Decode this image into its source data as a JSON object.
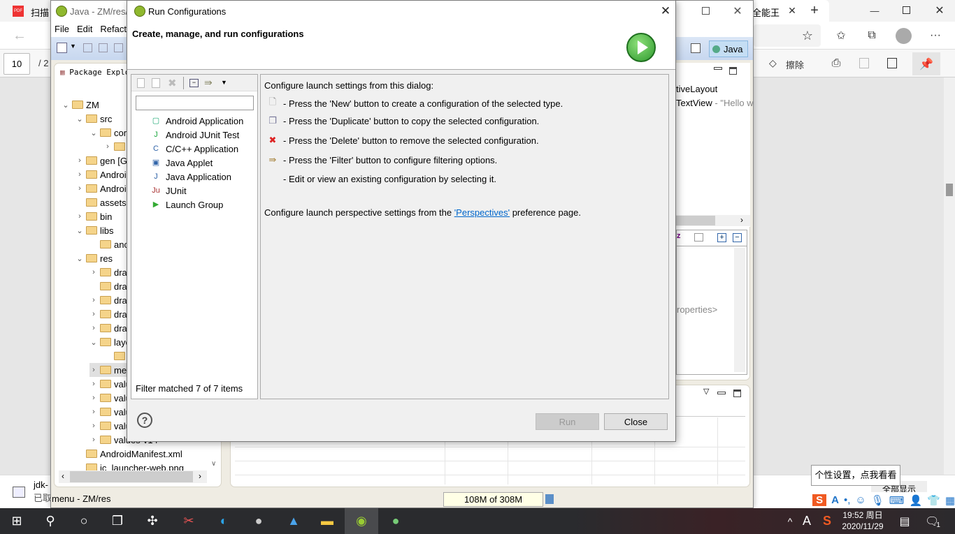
{
  "browser": {
    "tab1_title": "扫描",
    "tab2_title_fragment": "全能王",
    "page_input": "10",
    "page_total_fragment": "/ 2",
    "erase_label": "擦除",
    "download": {
      "name_fragment": "jdk-",
      "status_fragment": "已取",
      "show_all": "全部显示"
    }
  },
  "eclipse": {
    "title": "Java - ZM/res/",
    "menu": [
      "File",
      "Edit",
      "Refact"
    ],
    "perspective": "Java",
    "package_explorer_title": "Package Explor",
    "tree": [
      {
        "label": "ZM",
        "level": 0,
        "arrow": "open"
      },
      {
        "label": "src",
        "level": 1,
        "arrow": "open"
      },
      {
        "label": "cor",
        "level": 2,
        "arrow": "open"
      },
      {
        "label": "",
        "level": 3,
        "arrow": "closed"
      },
      {
        "label": "gen [G",
        "level": 1,
        "arrow": "closed"
      },
      {
        "label": "Androi",
        "level": 1,
        "arrow": "closed"
      },
      {
        "label": "Androi",
        "level": 1,
        "arrow": "closed"
      },
      {
        "label": "assets",
        "level": 1,
        "arrow": "none"
      },
      {
        "label": "bin",
        "level": 1,
        "arrow": "closed"
      },
      {
        "label": "libs",
        "level": 1,
        "arrow": "open"
      },
      {
        "label": "anc",
        "level": 2,
        "arrow": "none"
      },
      {
        "label": "res",
        "level": 1,
        "arrow": "open"
      },
      {
        "label": "dra",
        "level": 2,
        "arrow": "closed"
      },
      {
        "label": "dra",
        "level": 2,
        "arrow": "none"
      },
      {
        "label": "dra",
        "level": 2,
        "arrow": "closed"
      },
      {
        "label": "dra",
        "level": 2,
        "arrow": "closed"
      },
      {
        "label": "dra",
        "level": 2,
        "arrow": "closed"
      },
      {
        "label": "layo",
        "level": 2,
        "arrow": "open"
      },
      {
        "label": "",
        "level": 3,
        "arrow": "none"
      },
      {
        "label": "me",
        "level": 2,
        "arrow": "closed",
        "selected": true
      },
      {
        "label": "valu",
        "level": 2,
        "arrow": "closed"
      },
      {
        "label": "valu",
        "level": 2,
        "arrow": "closed"
      },
      {
        "label": "valu",
        "level": 2,
        "arrow": "closed"
      },
      {
        "label": "valu",
        "level": 2,
        "arrow": "closed"
      },
      {
        "label": "values-v14",
        "level": 2,
        "arrow": "closed"
      },
      {
        "label": "AndroidManifest.xml",
        "level": 1,
        "arrow": "none"
      },
      {
        "label": "ic_launcher-web.png",
        "level": 1,
        "arrow": "none"
      }
    ],
    "outline": [
      "tiveLayout",
      "TextView"
    ],
    "outline_hello": " - \"Hello w",
    "properties_hint": "roperties>",
    "status": "menu - ZM/res",
    "heap": "108M of 308M"
  },
  "dialog": {
    "title": "Run Configurations",
    "header": "Create, manage, and run configurations",
    "filter_placeholder": "",
    "types": [
      {
        "label": "Android Application",
        "icon": "android-app-icon"
      },
      {
        "label": "Android JUnit Test",
        "icon": "android-junit-icon"
      },
      {
        "label": "C/C++ Application",
        "icon": "c-app-icon"
      },
      {
        "label": "Java Applet",
        "icon": "java-applet-icon"
      },
      {
        "label": "Java Application",
        "icon": "java-app-icon"
      },
      {
        "label": "JUnit",
        "icon": "junit-icon"
      },
      {
        "label": "Launch Group",
        "icon": "launch-group-icon"
      }
    ],
    "filter_status": "Filter matched 7 of 7 items",
    "intro": "Configure launch settings from this dialog:",
    "instructions": [
      "- Press the 'New' button to create a configuration of the selected type.",
      "- Press the 'Duplicate' button to copy the selected configuration.",
      "- Press the 'Delete' button to remove the selected configuration.",
      "- Press the 'Filter' button to configure filtering options.",
      "- Edit or view an existing configuration by selecting it."
    ],
    "perspective_text_before": "Configure launch perspective settings from the ",
    "perspective_link": "'Perspectives'",
    "perspective_text_after": " preference page.",
    "run_label": "Run",
    "close_label": "Close",
    "link_color": "#0066cc"
  },
  "ime": {
    "tooltip": "个性设置，点我看看"
  },
  "taskbar": {
    "time": "19:52 周日",
    "date": "2020/11/29",
    "notification_count": "1",
    "ime_letter": "A"
  }
}
